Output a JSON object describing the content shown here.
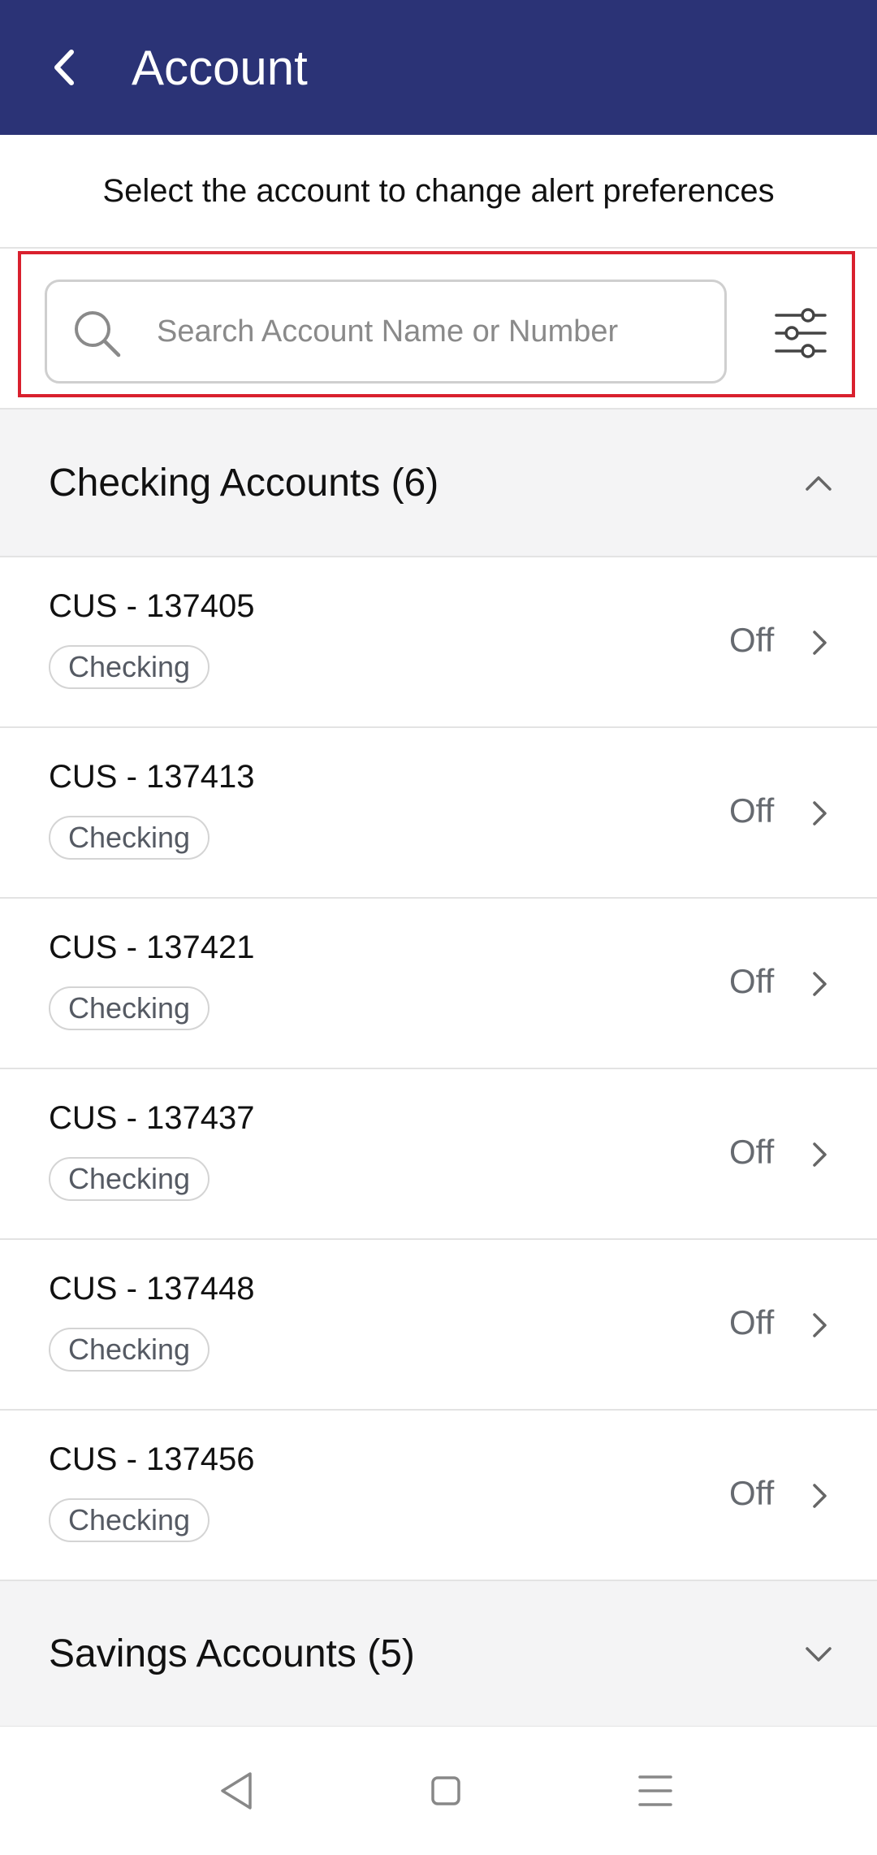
{
  "header": {
    "title": "Account",
    "back_icon": "chevron-left-icon"
  },
  "subtitle": "Select the account to change alert preferences",
  "search": {
    "placeholder": "Search Account Name or Number",
    "value": "",
    "search_icon": "search-icon",
    "filter_icon": "sliders-icon",
    "highlight_color": "#D9202E"
  },
  "sections": [
    {
      "title": "Checking Accounts (6)",
      "expanded": true,
      "chevron": "chevron-up-icon"
    },
    {
      "title": "Savings Accounts (5)",
      "expanded": false,
      "chevron": "chevron-down-icon"
    }
  ],
  "accounts": [
    {
      "name": "CUS - 137405",
      "type": "Checking",
      "status": "Off"
    },
    {
      "name": "CUS - 137413",
      "type": "Checking",
      "status": "Off"
    },
    {
      "name": "CUS - 137421",
      "type": "Checking",
      "status": "Off"
    },
    {
      "name": "CUS - 137437",
      "type": "Checking",
      "status": "Off"
    },
    {
      "name": "CUS - 137448",
      "type": "Checking",
      "status": "Off"
    },
    {
      "name": "CUS - 137456",
      "type": "Checking",
      "status": "Off"
    }
  ],
  "navbar": {
    "back_icon": "nav-back-icon",
    "home_icon": "nav-home-icon",
    "menu_icon": "nav-menu-icon"
  },
  "colors": {
    "header_bg": "#2B3376",
    "section_bg": "#F4F4F5"
  }
}
